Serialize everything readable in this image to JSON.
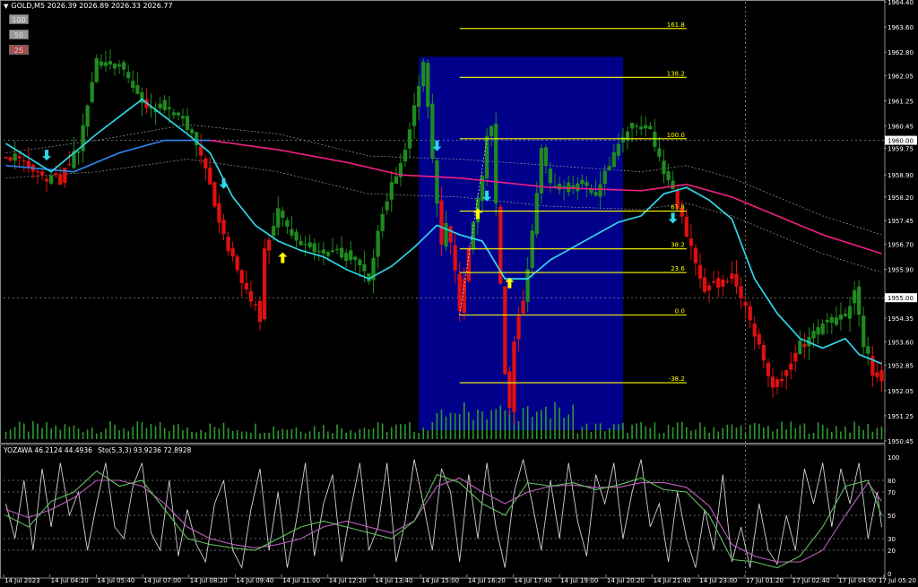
{
  "header": {
    "symbol": "GOLD,M5",
    "ohlc": "2026.39 2026.89 2026.33 2026.77"
  },
  "zoom_buttons": [
    "100",
    "50",
    "25"
  ],
  "subwindow": {
    "indicator1": "YOZAWA 46.2124 44.4936",
    "indicator2": "Sto(5,3,3) 93.9236 72.8928"
  },
  "colors": {
    "background": "#000000",
    "bull": "#1f8a1f",
    "bear": "#e01010",
    "zone": "#00008b",
    "fib": "#ffff00",
    "ma_fast": "#2fd6e8",
    "ma_mid": "#2f80e8",
    "ma_slow": "#e8207f",
    "arrow_down": "#2fd6e8",
    "arrow_up": "#ffff00",
    "axis_text": "#ffffff"
  },
  "chart_data": {
    "type": "candlestick",
    "price_axis": {
      "ylim": [
        1950.45,
        1964.4
      ],
      "ticks": [
        "1964.40",
        "1963.60",
        "1962.80",
        "1962.05",
        "1961.25",
        "1960.45",
        "1959.75",
        "1958.90",
        "1958.20",
        "1957.45",
        "1956.70",
        "1955.90",
        "1955.00",
        "1954.35",
        "1953.60",
        "1952.85",
        "1952.05",
        "1951.25",
        "1950.45"
      ],
      "current_price_label": "1960.00",
      "hline_label": "1955.00"
    },
    "time_axis": {
      "ticks": [
        "14 Jul 2023",
        "14 Jul 04:20",
        "14 Jul 05:40",
        "14 Jul 07:00",
        "14 Jul 08:20",
        "14 Jul 09:40",
        "14 Jul 11:00",
        "14 Jul 12:20",
        "14 Jul 13:40",
        "14 Jul 15:00",
        "14 Jul 16:20",
        "14 Jul 17:40",
        "14 Jul 19:00",
        "14 Jul 20:20",
        "14 Jul 21:40",
        "14 Jul 23:00",
        "17 Jul 01:20",
        "17 Jul 02:40",
        "17 Jul 04:00",
        "17 Jul 05:20"
      ]
    },
    "close_path": [
      [
        0,
        1959.6
      ],
      [
        6,
        1959.0
      ],
      [
        12,
        1958.7
      ],
      [
        16,
        1959.8
      ],
      [
        20,
        1962.5
      ],
      [
        26,
        1962.3
      ],
      [
        30,
        1961.1
      ],
      [
        35,
        1961.0
      ],
      [
        40,
        1960.5
      ],
      [
        44,
        1959.2
      ],
      [
        46,
        1958.0
      ],
      [
        49,
        1956.5
      ],
      [
        53,
        1955.2
      ],
      [
        56,
        1954.4
      ],
      [
        57,
        1956.4
      ],
      [
        60,
        1957.7
      ],
      [
        63,
        1957.0
      ],
      [
        67,
        1956.6
      ],
      [
        72,
        1956.5
      ],
      [
        78,
        1956.2
      ],
      [
        80,
        1955.5
      ],
      [
        82,
        1957.0
      ],
      [
        85,
        1958.5
      ],
      [
        88,
        1959.6
      ],
      [
        90,
        1961.2
      ],
      [
        92,
        1962.5
      ],
      [
        95,
        1958.0
      ],
      [
        96,
        1956.8
      ],
      [
        97,
        1957.5
      ],
      [
        99,
        1956.0
      ],
      [
        100,
        1954.6
      ],
      [
        102,
        1956.5
      ],
      [
        104,
        1958.0
      ],
      [
        106,
        1960.0
      ],
      [
        107,
        1960.5
      ],
      [
        109,
        1955.5
      ],
      [
        110,
        1952.5
      ],
      [
        111,
        1951.5
      ],
      [
        112,
        1953.5
      ],
      [
        114,
        1955.0
      ],
      [
        116,
        1957.0
      ],
      [
        118,
        1959.8
      ],
      [
        120,
        1958.5
      ],
      [
        122,
        1958.5
      ],
      [
        126,
        1958.6
      ],
      [
        130,
        1958.2
      ],
      [
        133,
        1959.2
      ],
      [
        138,
        1960.5
      ],
      [
        142,
        1960.2
      ],
      [
        145,
        1959.0
      ],
      [
        148,
        1958.0
      ],
      [
        150,
        1957.0
      ],
      [
        152,
        1956.2
      ],
      [
        154,
        1955.3
      ],
      [
        157,
        1955.4
      ],
      [
        160,
        1955.6
      ],
      [
        163,
        1954.8
      ],
      [
        166,
        1953.5
      ],
      [
        169,
        1952.2
      ],
      [
        172,
        1952.6
      ],
      [
        175,
        1953.5
      ],
      [
        178,
        1953.8
      ],
      [
        181,
        1954.3
      ],
      [
        185,
        1954.3
      ],
      [
        187,
        1955.2
      ],
      [
        189,
        1953.5
      ],
      [
        191,
        1952.6
      ],
      [
        193,
        1952.4
      ]
    ],
    "ma_fast": [
      [
        0,
        1959.9
      ],
      [
        10,
        1959.0
      ],
      [
        20,
        1960.2
      ],
      [
        30,
        1961.3
      ],
      [
        40,
        1960.2
      ],
      [
        45,
        1959.6
      ],
      [
        50,
        1958.2
      ],
      [
        55,
        1957.3
      ],
      [
        60,
        1956.8
      ],
      [
        65,
        1956.5
      ],
      [
        70,
        1956.3
      ],
      [
        75,
        1955.9
      ],
      [
        80,
        1955.6
      ],
      [
        85,
        1956.0
      ],
      [
        90,
        1956.6
      ],
      [
        95,
        1957.3
      ],
      [
        100,
        1957.0
      ],
      [
        105,
        1956.8
      ],
      [
        110,
        1955.6
      ],
      [
        115,
        1955.6
      ],
      [
        120,
        1956.2
      ],
      [
        125,
        1956.6
      ],
      [
        130,
        1957.0
      ],
      [
        135,
        1957.4
      ],
      [
        140,
        1957.6
      ],
      [
        145,
        1958.3
      ],
      [
        150,
        1958.5
      ],
      [
        155,
        1958.1
      ],
      [
        160,
        1957.5
      ],
      [
        165,
        1955.6
      ],
      [
        170,
        1954.5
      ],
      [
        175,
        1953.7
      ],
      [
        180,
        1953.4
      ],
      [
        185,
        1953.7
      ],
      [
        188,
        1953.2
      ],
      [
        193,
        1952.9
      ]
    ],
    "ma_mid": [
      [
        0,
        1959.2
      ],
      [
        15,
        1959.0
      ],
      [
        25,
        1959.6
      ],
      [
        35,
        1960.0
      ],
      [
        45,
        1960.0
      ]
    ],
    "ma_slow": [
      [
        45,
        1960.0
      ],
      [
        60,
        1959.7
      ],
      [
        75,
        1959.3
      ],
      [
        87,
        1958.9
      ],
      [
        100,
        1958.8
      ],
      [
        120,
        1958.5
      ],
      [
        140,
        1958.4
      ],
      [
        150,
        1958.6
      ],
      [
        160,
        1958.2
      ],
      [
        170,
        1957.6
      ],
      [
        180,
        1957.0
      ],
      [
        193,
        1956.4
      ]
    ],
    "envelope_upper": [
      [
        0,
        1959.6
      ],
      [
        20,
        1960.0
      ],
      [
        40,
        1960.5
      ],
      [
        60,
        1960.2
      ],
      [
        80,
        1959.5
      ],
      [
        100,
        1959.4
      ],
      [
        120,
        1959.2
      ],
      [
        140,
        1959.0
      ],
      [
        150,
        1959.2
      ],
      [
        160,
        1958.8
      ],
      [
        170,
        1958.2
      ],
      [
        180,
        1957.6
      ],
      [
        193,
        1957.0
      ]
    ],
    "envelope_lower": [
      [
        0,
        1958.8
      ],
      [
        20,
        1959.0
      ],
      [
        40,
        1959.4
      ],
      [
        60,
        1959.0
      ],
      [
        80,
        1958.3
      ],
      [
        100,
        1958.2
      ],
      [
        120,
        1957.9
      ],
      [
        140,
        1957.8
      ],
      [
        150,
        1958.0
      ],
      [
        160,
        1957.6
      ],
      [
        170,
        1957.0
      ],
      [
        180,
        1956.4
      ],
      [
        193,
        1955.8
      ]
    ],
    "zone": {
      "from_bar": 91,
      "to_bar": 136
    },
    "fibonacci": {
      "from_bar": 100,
      "to_bar": 150,
      "levels": [
        {
          "label": "161.8",
          "price": 1963.55
        },
        {
          "label": "138.2",
          "price": 1962.0
        },
        {
          "label": "100.0",
          "price": 1960.05
        },
        {
          "label": "61.8",
          "price": 1957.75
        },
        {
          "label": "38.2",
          "price": 1956.55
        },
        {
          "label": "23.6",
          "price": 1955.8
        },
        {
          "label": "0.0",
          "price": 1954.45
        },
        {
          "label": "-38.2",
          "price": 1952.3
        }
      ]
    },
    "arrows_down": [
      [
        9,
        1959.5
      ],
      [
        48,
        1958.6
      ],
      [
        95,
        1959.8
      ],
      [
        106,
        1958.2
      ],
      [
        147,
        1957.5
      ]
    ],
    "arrows_up": [
      [
        61,
        1956.3
      ],
      [
        104,
        1957.7
      ],
      [
        111,
        1955.5
      ]
    ],
    "oscillator": {
      "ylim": [
        0,
        100
      ],
      "ticks": [
        "100",
        "80",
        "70",
        "50",
        "30",
        "20",
        "0"
      ],
      "fast": [
        [
          0,
          50
        ],
        [
          5,
          40
        ],
        [
          10,
          62
        ],
        [
          15,
          70
        ],
        [
          20,
          88
        ],
        [
          25,
          75
        ],
        [
          30,
          80
        ],
        [
          35,
          55
        ],
        [
          40,
          30
        ],
        [
          45,
          25
        ],
        [
          50,
          22
        ],
        [
          55,
          20
        ],
        [
          60,
          30
        ],
        [
          65,
          40
        ],
        [
          70,
          45
        ],
        [
          75,
          40
        ],
        [
          80,
          35
        ],
        [
          85,
          30
        ],
        [
          90,
          45
        ],
        [
          95,
          85
        ],
        [
          100,
          78
        ],
        [
          105,
          60
        ],
        [
          110,
          50
        ],
        [
          115,
          78
        ],
        [
          120,
          75
        ],
        [
          125,
          78
        ],
        [
          130,
          72
        ],
        [
          135,
          76
        ],
        [
          140,
          82
        ],
        [
          145,
          72
        ],
        [
          150,
          70
        ],
        [
          155,
          50
        ],
        [
          160,
          12
        ],
        [
          165,
          10
        ],
        [
          170,
          5
        ],
        [
          175,
          15
        ],
        [
          180,
          40
        ],
        [
          185,
          75
        ],
        [
          190,
          80
        ],
        [
          193,
          50
        ]
      ],
      "slow": [
        [
          0,
          55
        ],
        [
          5,
          48
        ],
        [
          10,
          55
        ],
        [
          15,
          65
        ],
        [
          20,
          80
        ],
        [
          25,
          80
        ],
        [
          30,
          75
        ],
        [
          35,
          60
        ],
        [
          40,
          40
        ],
        [
          45,
          30
        ],
        [
          50,
          25
        ],
        [
          55,
          22
        ],
        [
          60,
          25
        ],
        [
          65,
          30
        ],
        [
          70,
          40
        ],
        [
          75,
          45
        ],
        [
          80,
          40
        ],
        [
          85,
          35
        ],
        [
          90,
          45
        ],
        [
          95,
          75
        ],
        [
          100,
          82
        ],
        [
          105,
          70
        ],
        [
          110,
          60
        ],
        [
          115,
          70
        ],
        [
          120,
          75
        ],
        [
          125,
          76
        ],
        [
          130,
          74
        ],
        [
          135,
          74
        ],
        [
          140,
          78
        ],
        [
          145,
          78
        ],
        [
          150,
          74
        ],
        [
          155,
          58
        ],
        [
          160,
          25
        ],
        [
          165,
          15
        ],
        [
          170,
          10
        ],
        [
          175,
          10
        ],
        [
          180,
          20
        ],
        [
          185,
          50
        ],
        [
          190,
          78
        ],
        [
          193,
          62
        ]
      ],
      "stoch": [
        [
          0,
          60
        ],
        [
          2,
          30
        ],
        [
          4,
          80
        ],
        [
          6,
          20
        ],
        [
          8,
          90
        ],
        [
          10,
          40
        ],
        [
          12,
          95
        ],
        [
          14,
          50
        ],
        [
          16,
          70
        ],
        [
          18,
          20
        ],
        [
          20,
          60
        ],
        [
          22,
          95
        ],
        [
          24,
          40
        ],
        [
          26,
          30
        ],
        [
          28,
          75
        ],
        [
          30,
          95
        ],
        [
          32,
          35
        ],
        [
          34,
          20
        ],
        [
          36,
          80
        ],
        [
          38,
          15
        ],
        [
          40,
          55
        ],
        [
          42,
          25
        ],
        [
          44,
          10
        ],
        [
          46,
          60
        ],
        [
          48,
          80
        ],
        [
          50,
          20
        ],
        [
          52,
          5
        ],
        [
          54,
          55
        ],
        [
          56,
          90
        ],
        [
          58,
          20
        ],
        [
          60,
          70
        ],
        [
          62,
          5
        ],
        [
          64,
          45
        ],
        [
          66,
          95
        ],
        [
          68,
          15
        ],
        [
          70,
          60
        ],
        [
          72,
          85
        ],
        [
          74,
          10
        ],
        [
          76,
          55
        ],
        [
          78,
          95
        ],
        [
          80,
          20
        ],
        [
          82,
          40
        ],
        [
          84,
          95
        ],
        [
          86,
          10
        ],
        [
          88,
          45
        ],
        [
          90,
          98
        ],
        [
          92,
          60
        ],
        [
          94,
          20
        ],
        [
          96,
          90
        ],
        [
          98,
          70
        ],
        [
          100,
          10
        ],
        [
          102,
          85
        ],
        [
          104,
          30
        ],
        [
          106,
          95
        ],
        [
          108,
          40
        ],
        [
          110,
          5
        ],
        [
          112,
          70
        ],
        [
          114,
          98
        ],
        [
          116,
          60
        ],
        [
          118,
          20
        ],
        [
          120,
          80
        ],
        [
          122,
          30
        ],
        [
          124,
          95
        ],
        [
          126,
          45
        ],
        [
          128,
          15
        ],
        [
          130,
          85
        ],
        [
          132,
          60
        ],
        [
          134,
          95
        ],
        [
          136,
          30
        ],
        [
          138,
          70
        ],
        [
          140,
          98
        ],
        [
          142,
          40
        ],
        [
          144,
          60
        ],
        [
          146,
          10
        ],
        [
          148,
          70
        ],
        [
          150,
          30
        ],
        [
          152,
          5
        ],
        [
          154,
          55
        ],
        [
          156,
          20
        ],
        [
          158,
          85
        ],
        [
          160,
          10
        ],
        [
          162,
          40
        ],
        [
          164,
          5
        ],
        [
          166,
          60
        ],
        [
          168,
          20
        ],
        [
          170,
          8
        ],
        [
          172,
          50
        ],
        [
          174,
          20
        ],
        [
          176,
          90
        ],
        [
          178,
          60
        ],
        [
          180,
          95
        ],
        [
          182,
          40
        ],
        [
          184,
          90
        ],
        [
          186,
          60
        ],
        [
          188,
          95
        ],
        [
          190,
          30
        ],
        [
          192,
          70
        ],
        [
          193,
          40
        ]
      ]
    }
  }
}
